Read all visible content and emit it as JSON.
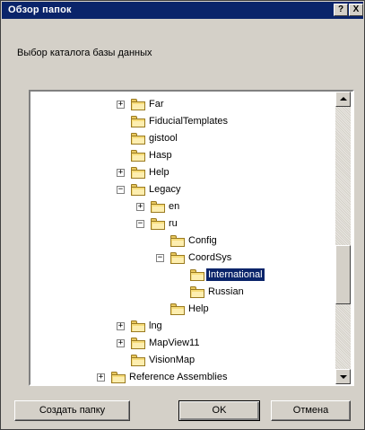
{
  "window": {
    "title": "Обзор папок",
    "help_glyph": "?",
    "close_glyph": "X"
  },
  "prompt": "Выбор каталога базы данных",
  "tree": {
    "items": [
      {
        "label": "Far",
        "expander": "+"
      },
      {
        "label": "FiducialTemplates",
        "expander": ""
      },
      {
        "label": "gistool",
        "expander": ""
      },
      {
        "label": "Hasp",
        "expander": ""
      },
      {
        "label": "Help",
        "expander": "+"
      },
      {
        "label": "Legacy",
        "expander": "−"
      },
      {
        "label": "en",
        "expander": "+"
      },
      {
        "label": "ru",
        "expander": "−"
      },
      {
        "label": "Config",
        "expander": ""
      },
      {
        "label": "CoordSys",
        "expander": "−"
      },
      {
        "label": "International",
        "expander": "",
        "selected": true
      },
      {
        "label": "Russian",
        "expander": ""
      },
      {
        "label": "Help",
        "expander": ""
      },
      {
        "label": "lng",
        "expander": "+"
      },
      {
        "label": "MapView11",
        "expander": "+"
      },
      {
        "label": "VisionMap",
        "expander": ""
      },
      {
        "label": "Reference Assemblies",
        "expander": "+"
      }
    ]
  },
  "buttons": {
    "new_folder": "Создать папку",
    "ok": "OK",
    "cancel": "Отмена"
  },
  "colors": {
    "titlebar": "#0a246a",
    "dialog_bg": "#d4d0c8",
    "selection": "#0a246a",
    "folder": "#f6dc7a"
  }
}
